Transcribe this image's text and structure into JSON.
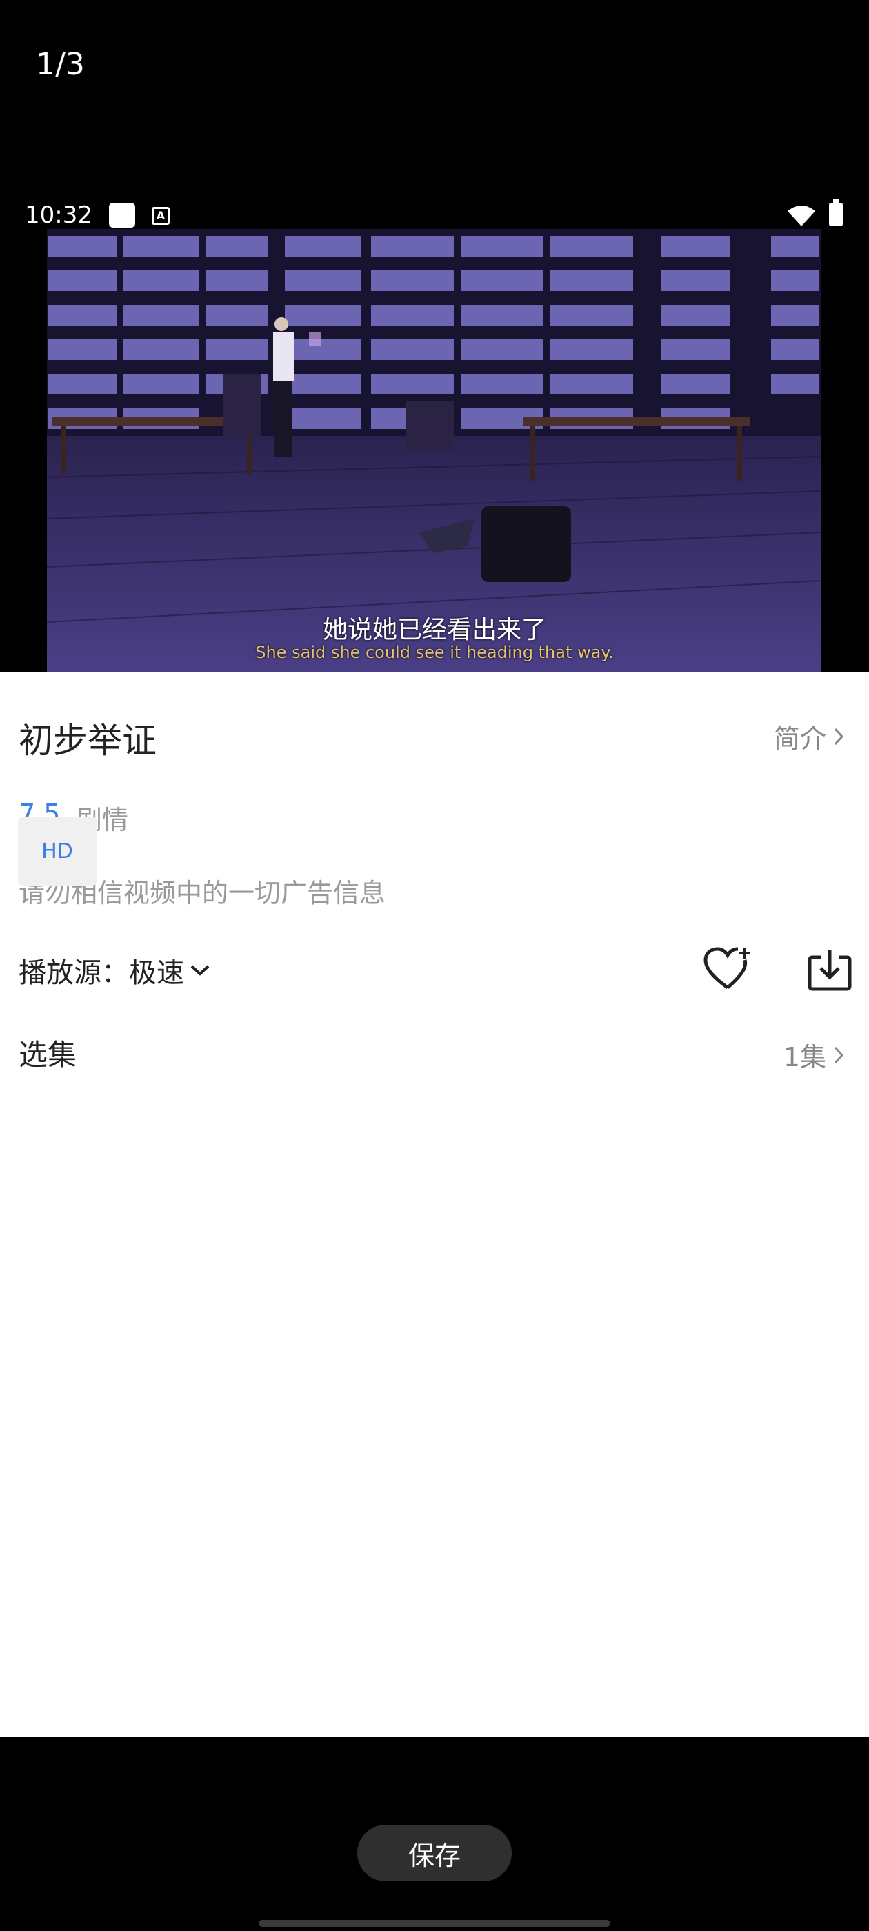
{
  "viewer": {
    "page_counter": "1/3",
    "save_label": "保存"
  },
  "status_bar": {
    "time": "10:32",
    "notification_icons": [
      "square-icon",
      "a-icon"
    ],
    "right_icons": [
      "wifi-icon",
      "battery-charging-icon"
    ]
  },
  "video": {
    "subtitle_zh": "她说她已经看出来了",
    "subtitle_en": "She said she could see it heading that way."
  },
  "detail": {
    "title": "初步举证",
    "intro_label": "简介",
    "rating": "7.5",
    "genre": "剧情",
    "notice": "请勿相信视频中的一切广告信息",
    "source_label": "播放源：极速",
    "episodes_label": "选集",
    "episode_count": "1集",
    "episodes": [
      "HD"
    ]
  },
  "colors": {
    "accent": "#3d7ee6",
    "muted": "#999999"
  }
}
